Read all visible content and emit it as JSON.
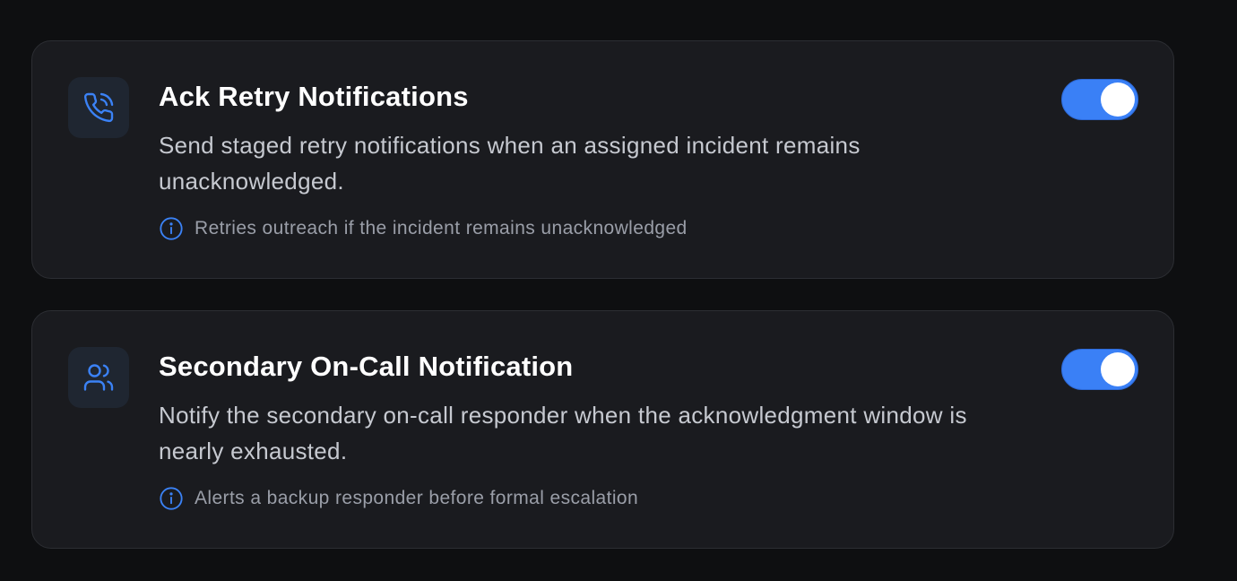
{
  "settings": [
    {
      "title": "Ack Retry Notifications",
      "description": "Send staged retry notifications when an assigned incident remains unacknowledged.",
      "hint": "Retries outreach if the incident remains unacknowledged",
      "icon": "phone-ringing-icon",
      "enabled": true
    },
    {
      "title": "Secondary On-Call Notification",
      "description": "Notify the secondary on-call responder when the acknowledgment window is nearly exhausted.",
      "hint": "Alerts a backup responder before formal escalation",
      "icon": "users-icon",
      "enabled": true
    }
  ],
  "colors": {
    "accent": "#3a80f6",
    "card_bg": "#1a1b1f",
    "page_bg": "#0e0f11"
  }
}
